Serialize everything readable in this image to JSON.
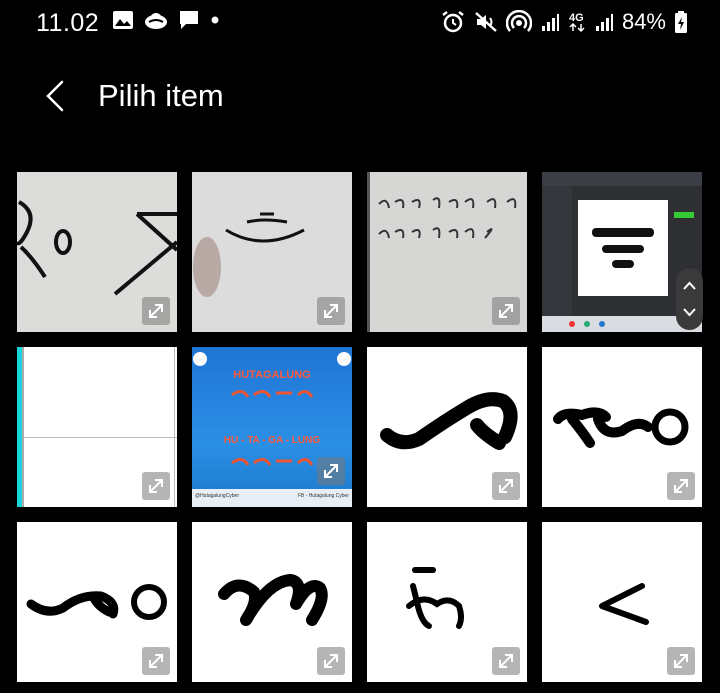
{
  "status_bar": {
    "time": "11.02",
    "left_icons": [
      "gallery-icon",
      "cloud-icon",
      "message-icon",
      "dot-icon"
    ],
    "right_icons": [
      "alarm-icon",
      "mute-icon",
      "hotspot-icon",
      "signal-icon",
      "network-4g-icon",
      "signal-icon-2",
      "battery-icon"
    ],
    "battery": "84%"
  },
  "header": {
    "back_icon": "chevron-left-icon",
    "title": "Pilih item"
  },
  "grid": {
    "items": [
      {
        "kind": "photo-script-ro"
      },
      {
        "kind": "photo-arcs"
      },
      {
        "kind": "photo-handwriting"
      },
      {
        "kind": "screenshot-ide"
      },
      {
        "kind": "blank-document"
      },
      {
        "kind": "poster",
        "title": "HUTAGALUNG",
        "subtitle": "HU - TA - GA - LUNG",
        "footer_left": "@HutagalungCyber",
        "footer_right": "FB - Hutagalung Cyber"
      },
      {
        "kind": "glyph-1"
      },
      {
        "kind": "glyph-2"
      },
      {
        "kind": "glyph-3"
      },
      {
        "kind": "glyph-4"
      },
      {
        "kind": "glyph-5"
      },
      {
        "kind": "glyph-6"
      }
    ],
    "expand_icon": "expand-icon"
  },
  "scroll_handle": {
    "icons": [
      "chevron-up-icon",
      "chevron-down-icon"
    ]
  }
}
